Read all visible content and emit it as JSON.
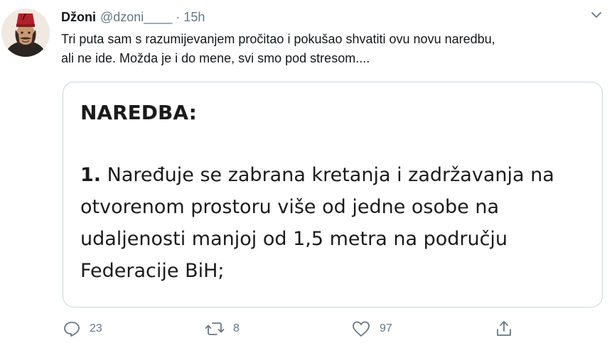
{
  "tweet": {
    "display_name": "Džoni",
    "handle": "@dzoni____",
    "separator": "·",
    "time": "15h",
    "text_lines": [
      "Tri puta sam s razumijevanjem pročitao i pokušao shvatiti ovu novu naredbu,",
      "ali ne ide. Možda je i do mene, svi smo pod stresom...."
    ]
  },
  "media": {
    "title": "NAREDBA:",
    "item_number": "1.",
    "body_lines": [
      "Naređuje se zabrana kretanja i zadržavanja na",
      "otvorenom prostoru više od jedne osobe na",
      "udaljenosti manjoj od 1,5 metra na području",
      "Federacije BiH;"
    ]
  },
  "actions": {
    "reply_count": "23",
    "retweet_count": "8",
    "like_count": "97"
  },
  "icons": {
    "caret": "chevron-down-icon",
    "reply": "reply-icon",
    "retweet": "retweet-icon",
    "like": "heart-icon",
    "share": "share-icon"
  },
  "colors": {
    "text": "#14171a",
    "secondary": "#657786",
    "border": "#ccd6dd",
    "avatar_fez": "#b3202a"
  }
}
